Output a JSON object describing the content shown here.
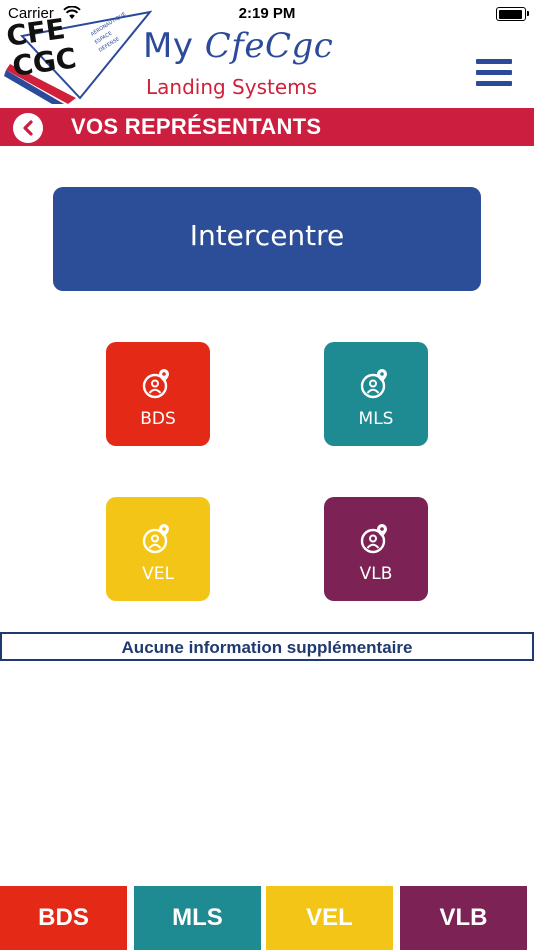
{
  "status_bar": {
    "carrier": "Carrier",
    "time": "2:19 PM",
    "battery_level": 0.95
  },
  "header": {
    "logo_text_top": "CFE",
    "logo_text_bottom": "CGC",
    "logo_side_text": [
      "AÉRONAUTIQUE",
      "ESPACE",
      "DÉFENSE"
    ],
    "title_prefix": "My",
    "title_brand": "CfeCgc",
    "subtitle": "Landing Systems",
    "menu_icon": "hamburger-icon"
  },
  "title_bar": {
    "back_icon": "chevron-left-icon",
    "title": "VOS REPRÉSENTANTS"
  },
  "intercentre": {
    "label": "Intercentre"
  },
  "tiles": [
    {
      "label": "BDS",
      "icon": "person-pin-icon",
      "color": "#e42916"
    },
    {
      "label": "MLS",
      "icon": "person-pin-icon",
      "color": "#1e8a92"
    },
    {
      "label": "VEL",
      "icon": "person-pin-icon",
      "color": "#f3c516"
    },
    {
      "label": "VLB",
      "icon": "person-pin-icon",
      "color": "#7c2254"
    }
  ],
  "info": {
    "text": "Aucune information supplémentaire"
  },
  "bottom_tabs": [
    {
      "label": "BDS",
      "color": "#e42916"
    },
    {
      "label": "MLS",
      "color": "#1e8a92"
    },
    {
      "label": "VEL",
      "color": "#f3c516"
    },
    {
      "label": "VLB",
      "color": "#7c2254"
    }
  ],
  "colors": {
    "brand_blue": "#2c4a9a",
    "brand_red": "#cc1f3f",
    "info_text": "#1f3a6e"
  }
}
